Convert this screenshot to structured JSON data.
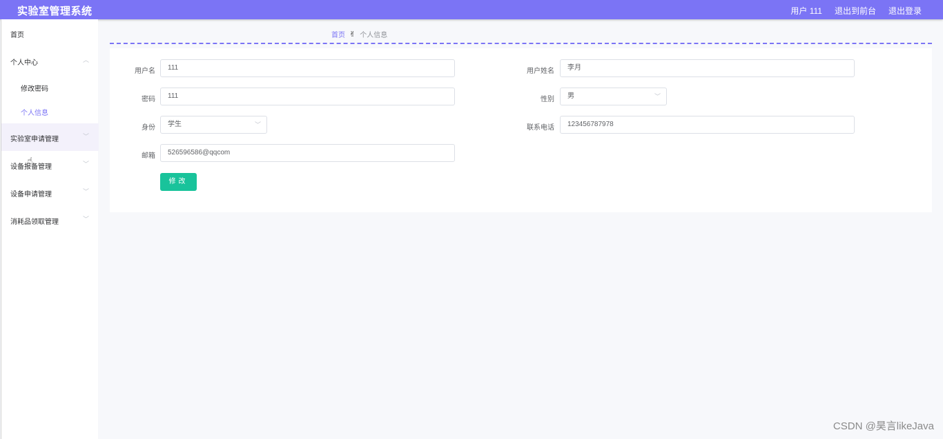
{
  "header": {
    "app_title": "实验室管理系统",
    "user": "用户 111",
    "exit_front": "退出到前台",
    "logout": "退出登录"
  },
  "sidebar": {
    "items": [
      {
        "label": "首页"
      },
      {
        "label": "个人中心"
      },
      {
        "label": "修改密码"
      },
      {
        "label": "个人信息"
      },
      {
        "label": "实验室申请管理"
      },
      {
        "label": "设备报备管理"
      },
      {
        "label": "设备申请管理"
      },
      {
        "label": "消耗品领取管理"
      }
    ]
  },
  "breadcrumb": {
    "home": "首页",
    "current": "个人信息"
  },
  "form": {
    "username_label": "用户名",
    "username_value": "111",
    "realname_label": "用户姓名",
    "realname_value": "李月",
    "password_label": "密码",
    "password_value": "111",
    "gender_label": "性别",
    "gender_value": "男",
    "identity_label": "身份",
    "identity_value": "学生",
    "phone_label": "联系电话",
    "phone_value": "123456787978",
    "email_label": "邮箱",
    "email_value": "526596586@qqcom",
    "submit_label": "修改"
  },
  "watermark": "CSDN @昊言likeJava",
  "colors": {
    "accent": "#7b74f5",
    "submit": "#19c39b"
  }
}
